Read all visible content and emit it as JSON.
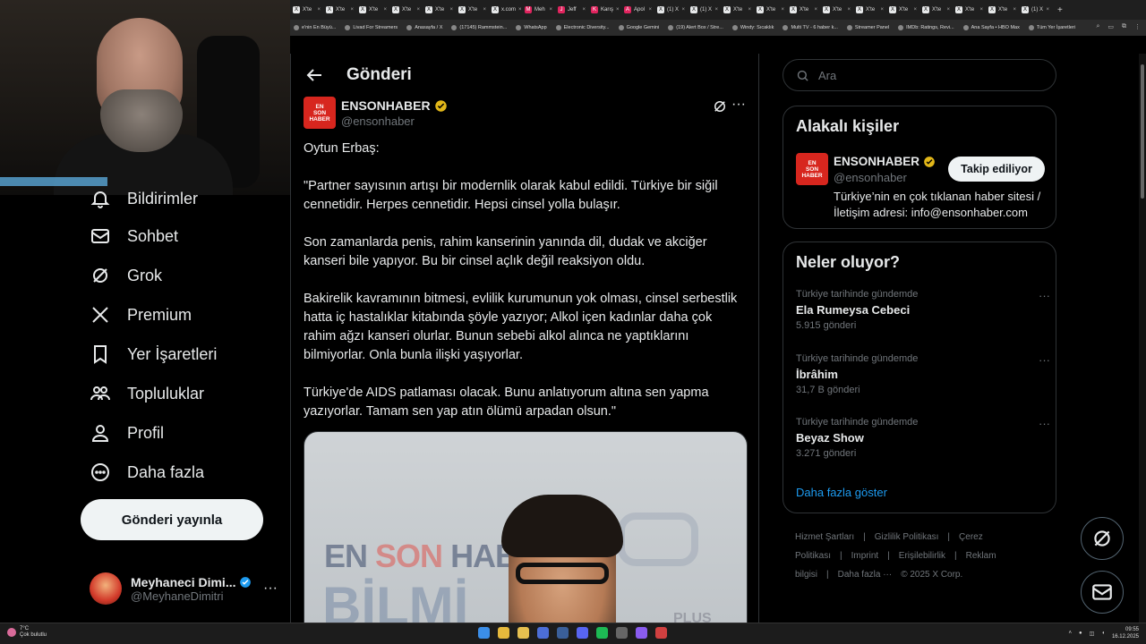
{
  "browser": {
    "tabs": [
      {
        "label": "X'te",
        "fav": "X"
      },
      {
        "label": "X'te",
        "fav": "X"
      },
      {
        "label": "X'te",
        "fav": "X"
      },
      {
        "label": "X'te",
        "fav": "X"
      },
      {
        "label": "X'te",
        "fav": "X"
      },
      {
        "label": "X'te",
        "fav": "X"
      },
      {
        "label": "x.com",
        "fav": "X"
      },
      {
        "label": "Meh",
        "fav": "M"
      },
      {
        "label": "Jeff",
        "fav": "J"
      },
      {
        "label": "Karış",
        "fav": "K"
      },
      {
        "label": "Apol",
        "fav": "A"
      },
      {
        "label": "(1) X",
        "fav": "X"
      },
      {
        "label": "(1) X",
        "fav": "X"
      },
      {
        "label": "X'te",
        "fav": "X"
      },
      {
        "label": "X'te",
        "fav": "X"
      },
      {
        "label": "X'te",
        "fav": "X"
      },
      {
        "label": "X'te",
        "fav": "X"
      },
      {
        "label": "X'te",
        "fav": "X"
      },
      {
        "label": "X'te",
        "fav": "X"
      },
      {
        "label": "X'te",
        "fav": "X"
      },
      {
        "label": "X'te",
        "fav": "X"
      },
      {
        "label": "X'te",
        "fav": "X"
      },
      {
        "label": "(1) X",
        "fav": "X"
      }
    ],
    "bookmarks": [
      "e'nin En Büyü...",
      "Livad For Streamers",
      "Anasayfa / X",
      "(17145) Rammstein...",
      "WhatsApp",
      "Electronic Diversity...",
      "Google Gemini",
      "(19) Alert Box / Stre...",
      "Windy: Sıcaklık",
      "Multi TV - 6 haber k...",
      "Streamer Panel",
      "IMDb: Ratings, Revi...",
      "Ana Sayfa • HBO Max",
      "Tüm Yer İşaretleri"
    ]
  },
  "nav": {
    "items": [
      {
        "label": "Bildirimler",
        "icon": "bell-icon"
      },
      {
        "label": "Sohbet",
        "icon": "mail-icon"
      },
      {
        "label": "Grok",
        "icon": "grok-icon"
      },
      {
        "label": "Premium",
        "icon": "x-logo-icon"
      },
      {
        "label": "Yer İşaretleri",
        "icon": "bookmark-icon"
      },
      {
        "label": "Topluluklar",
        "icon": "communities-icon"
      },
      {
        "label": "Profil",
        "icon": "person-icon"
      },
      {
        "label": "Daha fazla",
        "icon": "more-circle-icon"
      }
    ],
    "post_button": "Gönderi yayınla",
    "profile": {
      "name": "Meyhaneci Dimi...",
      "handle": "@MeyhaneDimitri"
    }
  },
  "main": {
    "title": "Gönderi",
    "author": {
      "name": "ENSONHABER",
      "handle": "@ensonhaber",
      "logo_text": "EN SON HABER"
    },
    "tweet_text": "Oytun Erbaş:\n\n\"Partner sayısının artışı bir modernlik olarak kabul edildi. Türkiye bir siğil cennetidir. Herpes cennetidir. Hepsi cinsel yolla bulaşır.\n\nSon zamanlarda penis, rahim kanserinin yanında dil, dudak ve akciğer kanseri bile yapıyor. Bu bir cinsel açlık değil reaksiyon oldu.\n\nBakirelik kavramının bitmesi, evlilik kurumunun yok olması, cinsel serbestlik hatta iç hastalıklar kitabında şöyle yazıyor; Alkol içen kadınlar daha çok rahim ağzı kanseri olurlar. Bunun sebebi alkol alınca ne yaptıklarını bilmiyorlar. Onla bunla ilişki yaşıyorlar.\n\nTürkiye'de AIDS patlaması olacak. Bunu anlatıyorum altına sen yapma yazıyorlar. Tamam sen yap atın ölümü arpadan olsun.\"",
    "media": {
      "brand_en": "EN",
      "brand_son": "SON",
      "brand_hab": "HAB",
      "big": "BİLMİ",
      "plus": "PLUS"
    }
  },
  "right": {
    "search_placeholder": "Ara",
    "related": {
      "title": "Alakalı kişiler",
      "name": "ENSONHABER",
      "handle": "@ensonhaber",
      "follow_label": "Takip ediliyor",
      "bio": "Türkiye’nin en çok tıklanan haber sitesi / İletişim adresi: info@ensonhaber.com"
    },
    "trends": {
      "title": "Neler oluyor?",
      "items": [
        {
          "context": "Türkiye tarihinde gündemde",
          "name": "Ela Rumeysa Cebeci",
          "count": "5.915 gönderi"
        },
        {
          "context": "Türkiye tarihinde gündemde",
          "name": "İbrâhim",
          "count": "31,7 B gönderi"
        },
        {
          "context": "Türkiye tarihinde gündemde",
          "name": "Beyaz Show",
          "count": "3.271 gönderi"
        }
      ],
      "show_more": "Daha fazla göster"
    },
    "footer": [
      "Hizmet Şartları",
      "|",
      "Gizlilik Politikası",
      "|",
      "Çerez Politikası",
      "|",
      "Imprint",
      "|",
      "Erişilebilirlik",
      "|",
      "Reklam bilgisi",
      "|",
      "Daha fazla ···",
      "© 2025 X Corp."
    ]
  },
  "taskbar": {
    "weather_temp": "7°C",
    "weather_desc": "Çok bulutlu",
    "time": "09:55",
    "date": "16.12.2025"
  },
  "colors": {
    "accent": "#1d9bf0",
    "brand_red": "#d7261e",
    "verified": "#e2b719"
  }
}
